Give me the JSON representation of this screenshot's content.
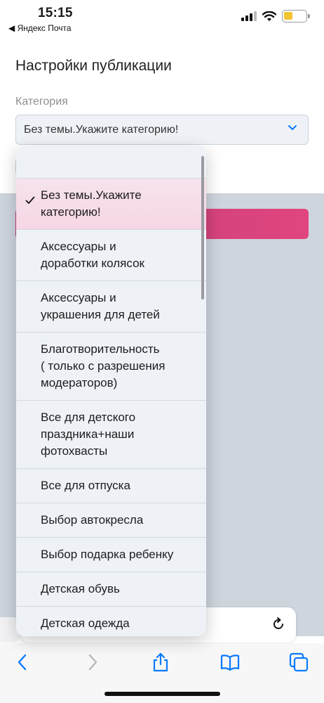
{
  "status_bar": {
    "time": "15:15",
    "back_app": "◀ Яндекс Почта"
  },
  "page": {
    "title": "Настройки публикации",
    "category_label": "Категория",
    "select_value": "Без темы.Укажите категорию!"
  },
  "dropdown": {
    "selected_index": 0,
    "items": [
      "Без темы.Укажите\nкатегорию!",
      "Аксессуары и\nдоработки колясок",
      "Аксессуары и\nукрашения для детей",
      "Благотворительность\n( только с разрешения\nмодераторов)",
      "Все для детского\nпраздника+наши\nфотохвасты",
      "Все для отпуска",
      "Выбор автокресла",
      "Выбор подарка ребенку",
      "Детская обувь",
      "Детская одежда"
    ]
  },
  "colors": {
    "accent": "#e0457f",
    "link": "#0a7aff",
    "dropdown_bg": "#eef2f6"
  },
  "icons": {
    "back": "chevron-left-icon",
    "forward": "chevron-right-icon",
    "share": "share-icon",
    "bookmarks": "book-icon",
    "tabs": "tabs-icon",
    "reload": "reload-icon"
  }
}
